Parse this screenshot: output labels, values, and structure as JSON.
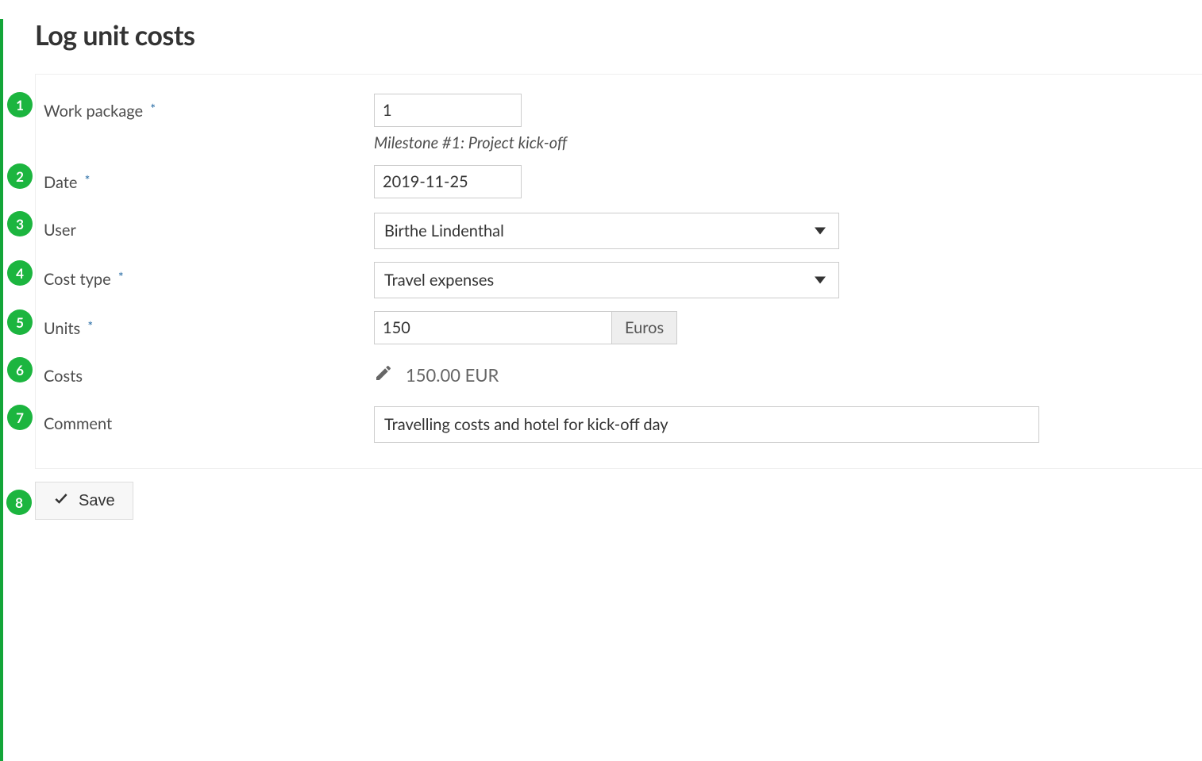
{
  "page": {
    "title": "Log unit costs"
  },
  "badges": {
    "work_package": "1",
    "date": "2",
    "user": "3",
    "cost_type": "4",
    "units": "5",
    "costs": "6",
    "comment": "7",
    "save": "8"
  },
  "labels": {
    "work_package": "Work package",
    "date": "Date",
    "user": "User",
    "cost_type": "Cost type",
    "units": "Units",
    "costs": "Costs",
    "comment": "Comment"
  },
  "fields": {
    "work_package": {
      "value": "1",
      "subtitle": "Milestone #1: Project kick-off"
    },
    "date": {
      "value": "2019-11-25"
    },
    "user": {
      "value": "Birthe Lindenthal"
    },
    "cost_type": {
      "value": "Travel expenses"
    },
    "units": {
      "value": "150",
      "suffix": "Euros"
    },
    "costs": {
      "value": "150.00 EUR"
    },
    "comment": {
      "value": "Travelling costs and hotel for kick-off day"
    }
  },
  "actions": {
    "save_label": "Save"
  },
  "colors": {
    "badge_green": "#1cb53f",
    "left_bar_green": "#13a538"
  }
}
